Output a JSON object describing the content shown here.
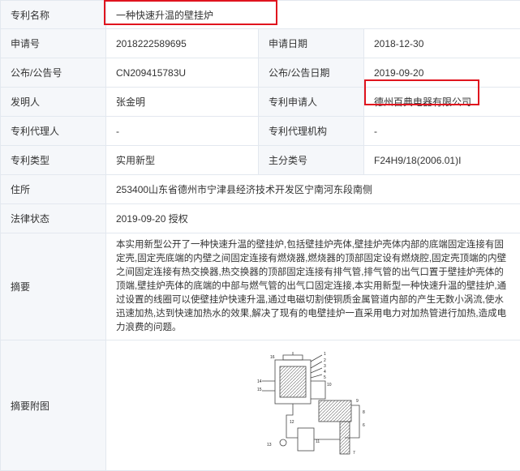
{
  "rows": {
    "title": {
      "label": "专利名称",
      "value": "一种快速升温的壁挂炉"
    },
    "app_no": {
      "label": "申请号",
      "value": "2018222589695",
      "label2": "申请日期",
      "value2": "2018-12-30"
    },
    "pub_no": {
      "label": "公布/公告号",
      "value": "CN209415783U",
      "label2": "公布/公告日期",
      "value2": "2019-09-20"
    },
    "inventor": {
      "label": "发明人",
      "value": "张金明",
      "label2": "专利申请人",
      "value2": "德州百典电器有限公司"
    },
    "agent": {
      "label": "专利代理人",
      "value": "-",
      "label2": "专利代理机构",
      "value2": "-"
    },
    "type": {
      "label": "专利类型",
      "value": "实用新型",
      "label2": "主分类号",
      "value2": "F24H9/18(2006.01)I"
    },
    "address": {
      "label": "住所",
      "value": "253400山东省德州市宁津县经济技术开发区宁南河东段南侧"
    },
    "legal": {
      "label": "法律状态",
      "value": "2019-09-20 授权"
    },
    "abstract": {
      "label": "摘要",
      "value": "本实用新型公开了一种快速升温的壁挂炉,包括壁挂炉壳体,壁挂炉壳体内部的底端固定连接有固定壳,固定壳底端的内壁之间固定连接有燃烧器,燃烧器的顶部固定设有燃烧腔,固定壳顶端的内壁之间固定连接有热交换器,热交换器的顶部固定连接有排气管,排气管的出气口置于壁挂炉壳体的顶端,壁挂炉壳体的底端的中部与燃气管的出气口固定连接,本实用新型一种快速升温的壁挂炉,通过设置的线圈可以使壁挂炉快速升温,通过电磁切割使铜质金属管道内部的产生无数小涡流,使水迅速加热,达到快速加热水的效果,解决了现有的电壁挂炉一直采用电力对加热管进行加热,造成电力浪费的问题。"
    },
    "figure": {
      "label": "摘要附图"
    }
  },
  "figure_labels": [
    "1",
    "2",
    "3",
    "4",
    "5",
    "6",
    "7",
    "8",
    "9",
    "10",
    "11",
    "12",
    "13",
    "14",
    "15",
    "16"
  ],
  "colors": {
    "highlight": "#e0141e",
    "label_bg": "#f5f7fa",
    "border": "#e3e8ef"
  }
}
